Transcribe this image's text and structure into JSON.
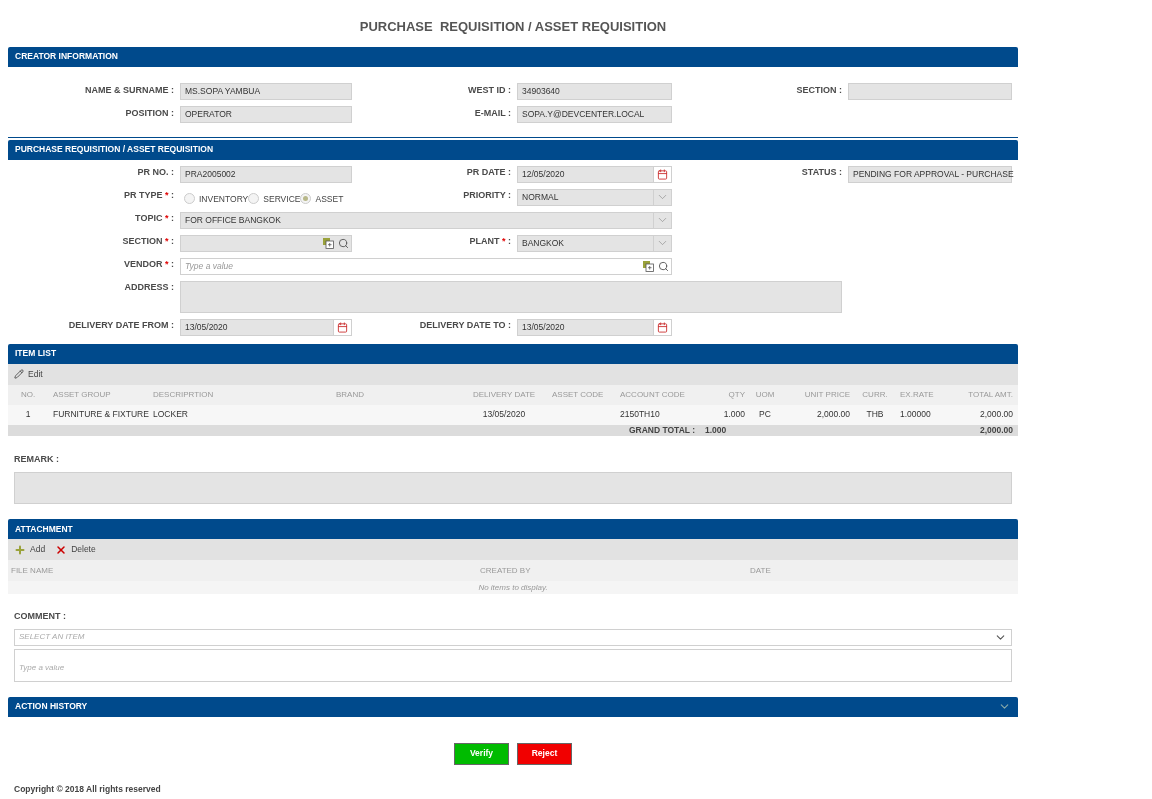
{
  "page_title": "PURCHASE  REQUISITION / ASSET REQUISITION",
  "creator_information": {
    "title": "CREATOR INFORMATION",
    "name_surname": {
      "label": "NAME & SURNAME :",
      "kind": "text",
      "value": "MS.SOPA YAMBUA",
      "disabled": true
    },
    "west_id": {
      "label": "WEST ID :",
      "kind": "text",
      "value": "34903640",
      "disabled": true
    },
    "section": {
      "label": "SECTION :",
      "kind": "text",
      "disabled": true
    },
    "position": {
      "label": "POSITION :",
      "kind": "text",
      "value": "OPERATOR",
      "disabled": true
    },
    "email": {
      "label": "E-MAIL :",
      "kind": "text",
      "value": "SOPA.Y@DEVCENTER.LOCAL",
      "disabled": true
    }
  },
  "purchase_requisition": {
    "title": "PURCHASE REQUISITION / ASSET REQUISITION",
    "pr_no": {
      "label": "PR NO. :",
      "kind": "text",
      "value": "PRA2005002",
      "disabled": true
    },
    "pr_date": {
      "label": "PR DATE :",
      "kind": "date",
      "value": "12/05/2020",
      "disabled": true
    },
    "status": {
      "label": "STATUS :",
      "kind": "text",
      "value": "PENDING FOR APPROVAL - PURCHASE",
      "disabled": true
    },
    "pr_type": {
      "label": "PR TYPE",
      "required_mark": "*",
      "suffix": ":",
      "options": [
        {
          "label": "INVENTORY",
          "selected": false
        },
        {
          "label": "SERVICE",
          "selected": false
        },
        {
          "label": "ASSET",
          "selected": true
        }
      ]
    },
    "priority": {
      "label": "PRIORITY :",
      "kind": "select",
      "value": "NORMAL",
      "disabled": true
    },
    "topic": {
      "label": "TOPIC",
      "required_mark": "*",
      "suffix": ":",
      "kind": "select",
      "value": "FOR OFFICE BANGKOK",
      "disabled": true
    },
    "section": {
      "label": "SECTION",
      "required_mark": "*",
      "suffix": ":",
      "kind": "lookup",
      "disabled": true
    },
    "plant": {
      "label": "PLANT",
      "required_mark": "*",
      "suffix": ":",
      "kind": "select",
      "value": "BANGKOK",
      "disabled": true
    },
    "vendor": {
      "label": "VENDOR",
      "required_mark": "*",
      "suffix": ":",
      "kind": "lookup",
      "placeholder": "Type a value",
      "disabled": false
    },
    "address": {
      "label": "ADDRESS :",
      "kind": "textarea",
      "disabled": true
    },
    "delivery_date_from": {
      "label": "DELIVERY DATE FROM :",
      "kind": "date",
      "value": "13/05/2020",
      "disabled": true
    },
    "delivery_date_to": {
      "label": "DELIVERY DATE TO :",
      "kind": "date",
      "value": "13/05/2020",
      "disabled": true
    }
  },
  "item_list": {
    "title": "ITEM LIST",
    "toolbar": [
      {
        "kind": "edit",
        "label": "Edit"
      }
    ],
    "columns": [
      "NO.",
      "ASSET GROUP",
      "DESCRIPRTION",
      "BRAND",
      "DELIVERY DATE",
      "ASSET CODE",
      "ACCOUNT CODE",
      "QTY",
      "UOM",
      "UNIT PRICE",
      "CURR.",
      "EX.RATE",
      "TOTAL AMT."
    ],
    "rows": [
      [
        "1",
        "FURNITURE & FIXTURE",
        "LOCKER",
        "",
        "13/05/2020",
        "",
        "2150TH10",
        "1.000",
        "PC",
        "2,000.00",
        "THB",
        "1.00000",
        "2,000.00"
      ]
    ],
    "grand_total": {
      "label": "GRAND TOTAL :",
      "qty": "1.000",
      "total_amt": "2,000.00"
    }
  },
  "remark": {
    "label": "REMARK :",
    "kind": "textarea",
    "disabled": true
  },
  "attachment": {
    "title": "ATTACHMENT",
    "toolbar": [
      {
        "kind": "add",
        "label": "Add"
      },
      {
        "kind": "delete",
        "label": "Delete"
      }
    ],
    "columns": [
      "FILE NAME",
      "CREATED BY",
      "DATE"
    ],
    "empty_message": "No items to display."
  },
  "comment": {
    "label": "COMMENT :",
    "select": {
      "placeholder": "SELECT AN ITEM"
    },
    "text": {
      "placeholder": "Type a value"
    }
  },
  "action_history": {
    "title": "ACTION HISTORY",
    "expanded": false
  },
  "buttons": [
    {
      "kind": "verify",
      "label": "Verify"
    },
    {
      "kind": "reject",
      "label": "Reject"
    }
  ],
  "footer": "Copyright © 2018 All rights reserved"
}
